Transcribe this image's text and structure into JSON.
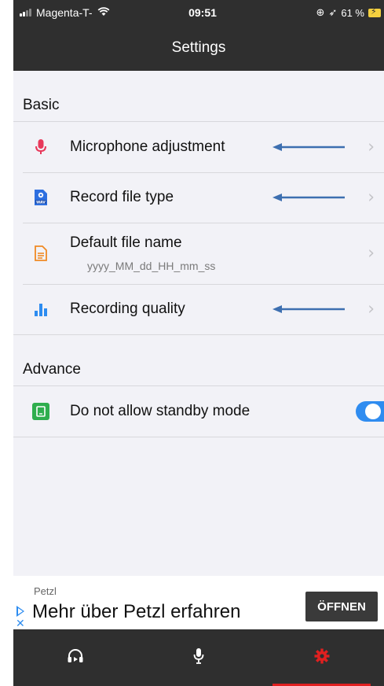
{
  "status_bar": {
    "carrier": "Magenta-T-",
    "time": "09:51",
    "battery": "61 %"
  },
  "nav": {
    "title": "Settings"
  },
  "sections": {
    "basic": {
      "title": "Basic",
      "items": [
        {
          "label": "Microphone adjustment",
          "icon": "microphone-icon"
        },
        {
          "label": "Record file type",
          "icon": "wav-file-icon"
        },
        {
          "label": "Default file name",
          "value": "yyyy_MM_dd_HH_mm_ss",
          "icon": "document-icon"
        },
        {
          "label": "Recording quality",
          "icon": "bar-chart-icon"
        }
      ]
    },
    "advance": {
      "title": "Advance",
      "items": [
        {
          "label": "Do not allow standby mode",
          "icon": "standby-icon",
          "toggle_on": true
        }
      ]
    }
  },
  "ad": {
    "brand": "Petzl",
    "headline": "Mehr über Petzl erfahren",
    "button_label": "ÖFFNEN"
  },
  "tabs": [
    {
      "name": "player",
      "icon": "headphones-icon"
    },
    {
      "name": "record",
      "icon": "microphone-icon"
    },
    {
      "name": "settings",
      "icon": "gear-icon",
      "active": true
    }
  ],
  "colors": {
    "accent_blue": "#2f8cf0",
    "active_tab": "#e02020",
    "annotation_arrow": "#3d6fb0"
  }
}
